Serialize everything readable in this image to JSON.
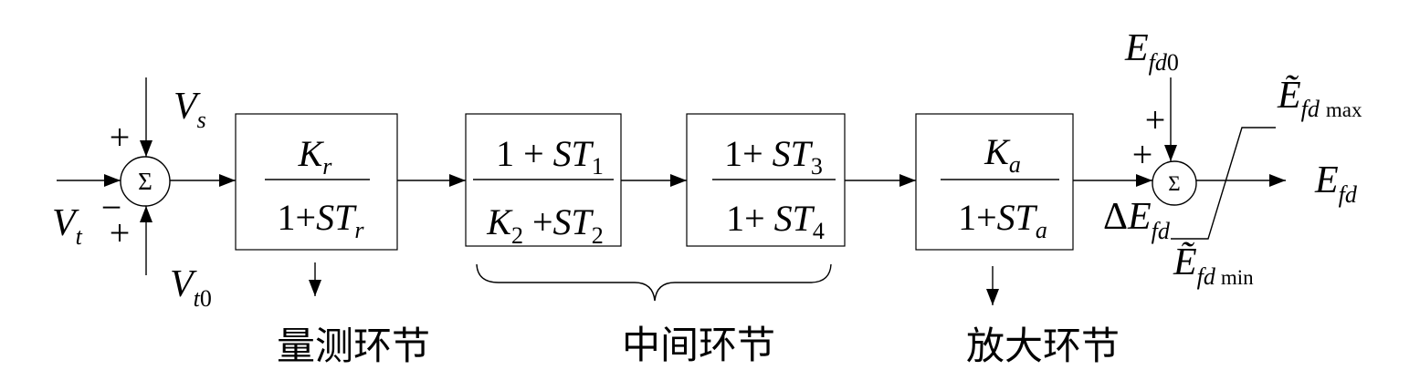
{
  "junction_1": {
    "symbol": "Σ",
    "sign_top": "+",
    "sign_minus": "−",
    "sign_bottom": "+"
  },
  "signal_vs": {
    "var": "V",
    "sub": "s"
  },
  "signal_vt": {
    "var": "V",
    "sub": "t"
  },
  "signal_vt0": {
    "var": "V",
    "sub": "t",
    "sub_index": "0"
  },
  "measurement_block": {
    "numerator": {
      "var": "K",
      "sub": "r"
    },
    "denominator": {
      "const": "1+",
      "var": "ST",
      "sub": "r"
    },
    "label": "量测环节"
  },
  "lead_lag_block_1": {
    "numerator": {
      "const": "1 + ",
      "var": "ST",
      "sub": "1"
    },
    "denominator": {
      "var": "K",
      "sub": "2",
      "const": " +",
      "var2": "ST",
      "sub2": "2"
    }
  },
  "lead_lag_block_2": {
    "numerator": {
      "const": "1+ ",
      "var": "ST",
      "sub": "3"
    },
    "denominator": {
      "const": "1+ ",
      "var": "ST",
      "sub": "4"
    }
  },
  "intermediate_stage": {
    "label": "中间环节"
  },
  "amplifier_block": {
    "numerator": {
      "var": "K",
      "sub": "a"
    },
    "denominator": {
      "const": "1+",
      "var": "ST",
      "sub": "a"
    },
    "label": "放大环节"
  },
  "junction_2": {
    "symbol": "Σ",
    "sign_top": "+",
    "sign_left": "+"
  },
  "signal_efd0": {
    "var": "E",
    "sub": "fd",
    "sub_index": "0"
  },
  "signal_delta_efd": {
    "prefix": "Δ",
    "var": "E",
    "sub": "fd"
  },
  "limit_max": {
    "var": "Ẽ",
    "sub": "fd",
    "qualifier": "max"
  },
  "limit_min": {
    "var": "Ẽ",
    "sub": "fd",
    "qualifier": "min"
  },
  "signal_efd": {
    "var": "E",
    "sub": "fd"
  }
}
